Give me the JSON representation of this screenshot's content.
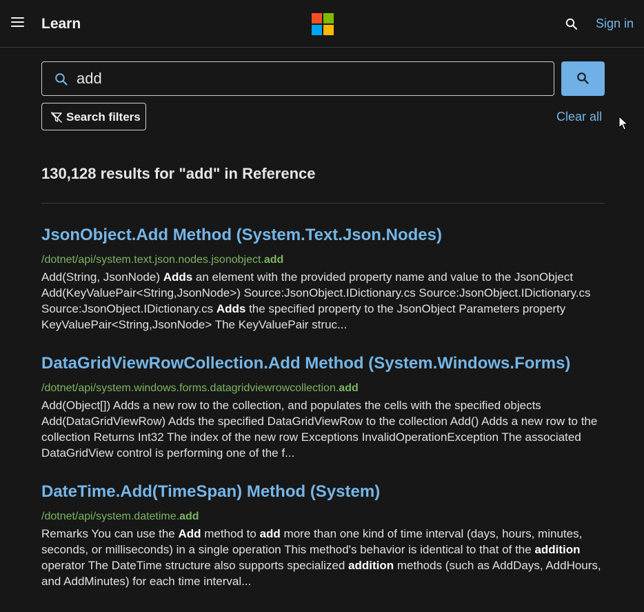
{
  "header": {
    "menu_icon": "hamburger-menu-icon",
    "brand": "Learn",
    "logo": "microsoft-logo",
    "logo_colors": [
      "#f25022",
      "#7fba00",
      "#00a4ef",
      "#ffb900"
    ],
    "search_icon": "search-icon",
    "sign_in": "Sign in"
  },
  "search": {
    "query": "add",
    "search_icon": "search-icon",
    "submit_icon": "search-icon",
    "filters_label": "Search filters",
    "filters_icon": "filter-icon",
    "clear_all": "Clear all"
  },
  "results_count": "130,128 results for \"add\" in Reference",
  "results": [
    {
      "title": "JsonObject.Add Method (System.Text.Json.Nodes)",
      "url_prefix": "/dotnet/api/system.text.json.nodes.jsonobject.",
      "url_highlight": "add",
      "description": [
        {
          "t": "Add(String, JsonNode) "
        },
        {
          "t": "Adds",
          "b": true
        },
        {
          "t": " an element with the provided property name and value to the JsonObject Add(KeyValuePair<String,JsonNode>) Source:JsonObject.IDictionary.cs Source:JsonObject.IDictionary.cs Source:JsonObject.IDictionary.cs "
        },
        {
          "t": "Adds",
          "b": true
        },
        {
          "t": " the specified property to the JsonObject Parameters property KeyValuePair<String,JsonNode> The KeyValuePair struc..."
        }
      ]
    },
    {
      "title": "DataGridViewRowCollection.Add Method (System.Windows.Forms)",
      "url_prefix": "/dotnet/api/system.windows.forms.datagridviewrowcollection.",
      "url_highlight": "add",
      "description": [
        {
          "t": "Add(Object[]) Adds a new row to the collection, and populates the cells with the specified objects Add(DataGridViewRow) Adds the specified DataGridViewRow to the collection Add() Adds a new row to the collection Returns Int32 The index of the new row Exceptions InvalidOperationException The associated DataGridView control is performing one of the f..."
        }
      ]
    },
    {
      "title": "DateTime.Add(TimeSpan) Method (System)",
      "url_prefix": "/dotnet/api/system.datetime.",
      "url_highlight": "add",
      "description": [
        {
          "t": "Remarks You can use the "
        },
        {
          "t": "Add",
          "b": true
        },
        {
          "t": " method to "
        },
        {
          "t": "add",
          "b": true
        },
        {
          "t": " more than one kind of time interval (days, hours, minutes, seconds, or milliseconds) in a single operation This method's behavior is identical to that of the "
        },
        {
          "t": "addition",
          "b": true
        },
        {
          "t": " operator The DateTime structure also supports specialized "
        },
        {
          "t": "addition",
          "b": true
        },
        {
          "t": " methods (such as AddDays, AddHours, and AddMinutes) for each time interval..."
        }
      ]
    }
  ]
}
